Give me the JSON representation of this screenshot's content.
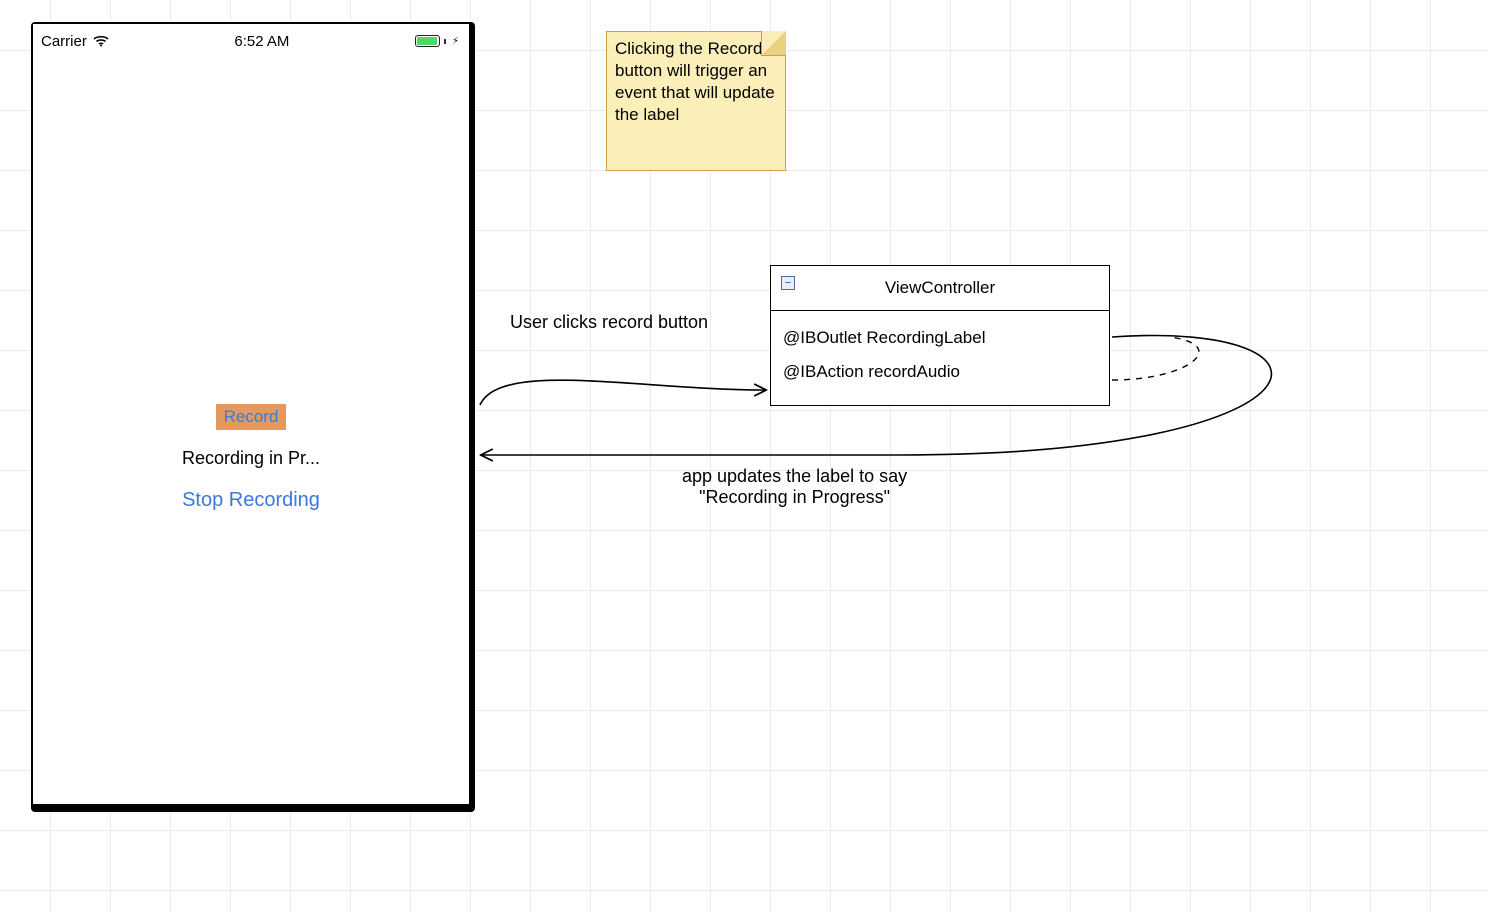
{
  "phone": {
    "carrier": "Carrier",
    "time": "6:52 AM",
    "record_button": "Record",
    "recording_label": "Recording in Pr...",
    "stop_button": "Stop Recording"
  },
  "note": {
    "text": "Clicking the Record button will trigger an event that will update the label"
  },
  "class_box": {
    "title": "ViewController",
    "outlet": "@IBOutlet RecordingLabel",
    "action": "@IBAction recordAudio",
    "collapse_glyph": "−"
  },
  "labels": {
    "user_clicks": "User clicks record button",
    "app_updates": "app updates the label to say\n\"Recording in Progress\""
  }
}
